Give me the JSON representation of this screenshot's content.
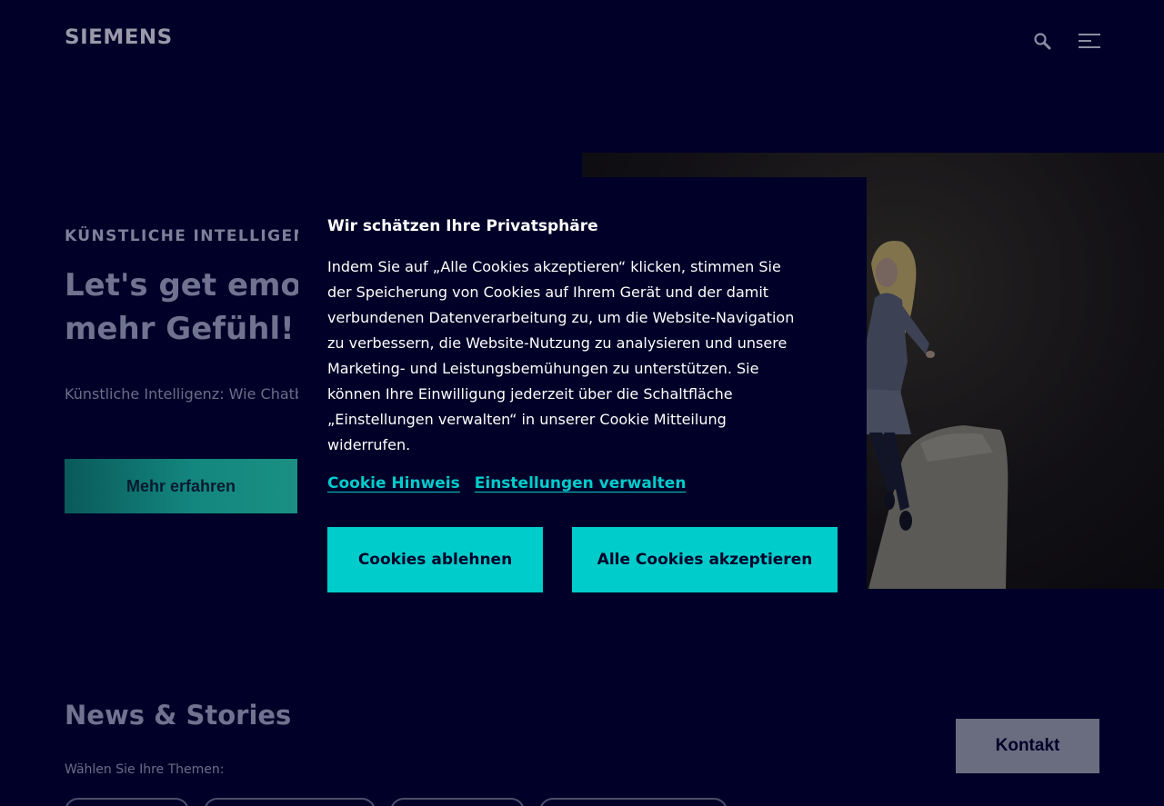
{
  "header": {
    "logo_text": "SIEMENS",
    "search_icon": "search-icon",
    "menu_icon": "menu-icon"
  },
  "hero": {
    "eyebrow": "KÜNSTLICHE INTELLIGENZ",
    "title": "Let's get emotional – zeig mehr Gefühl!",
    "text": "Künstliche Intelligenz: Wie Chatbots Empathie lernen.",
    "cta_label": "Mehr erfahren"
  },
  "news": {
    "title": "News & Stories",
    "topics_label": "Wählen Sie Ihre Themen:",
    "contact_label": "Kontakt"
  },
  "cookie_modal": {
    "title": "Wir schätzen Ihre Privatsphäre",
    "body": "Indem Sie auf „Alle Cookies akzeptieren“ klicken, stimmen Sie der Speicherung von Cookies auf Ihrem Gerät und der damit verbundenen Datenverarbeitung zu, um die Website-Navigation zu verbessern, die Website-Nutzung zu analysieren und unsere Marketing- und Leistungsbemühungen zu unterstützen. Sie können Ihre Einwilligung jederzeit über die Schaltfläche „Einstellungen verwalten“ in unserer Cookie Mitteilung widerrufen.",
    "link_cookie_notice": "Cookie Hinweis",
    "link_manage_settings": "Einstellungen verwalten",
    "reject_label": "Cookies ablehnen",
    "accept_label": "Alle Cookies akzeptieren"
  },
  "colors": {
    "background": "#000028",
    "accent": "#00cccc",
    "text": "#ffffff"
  }
}
